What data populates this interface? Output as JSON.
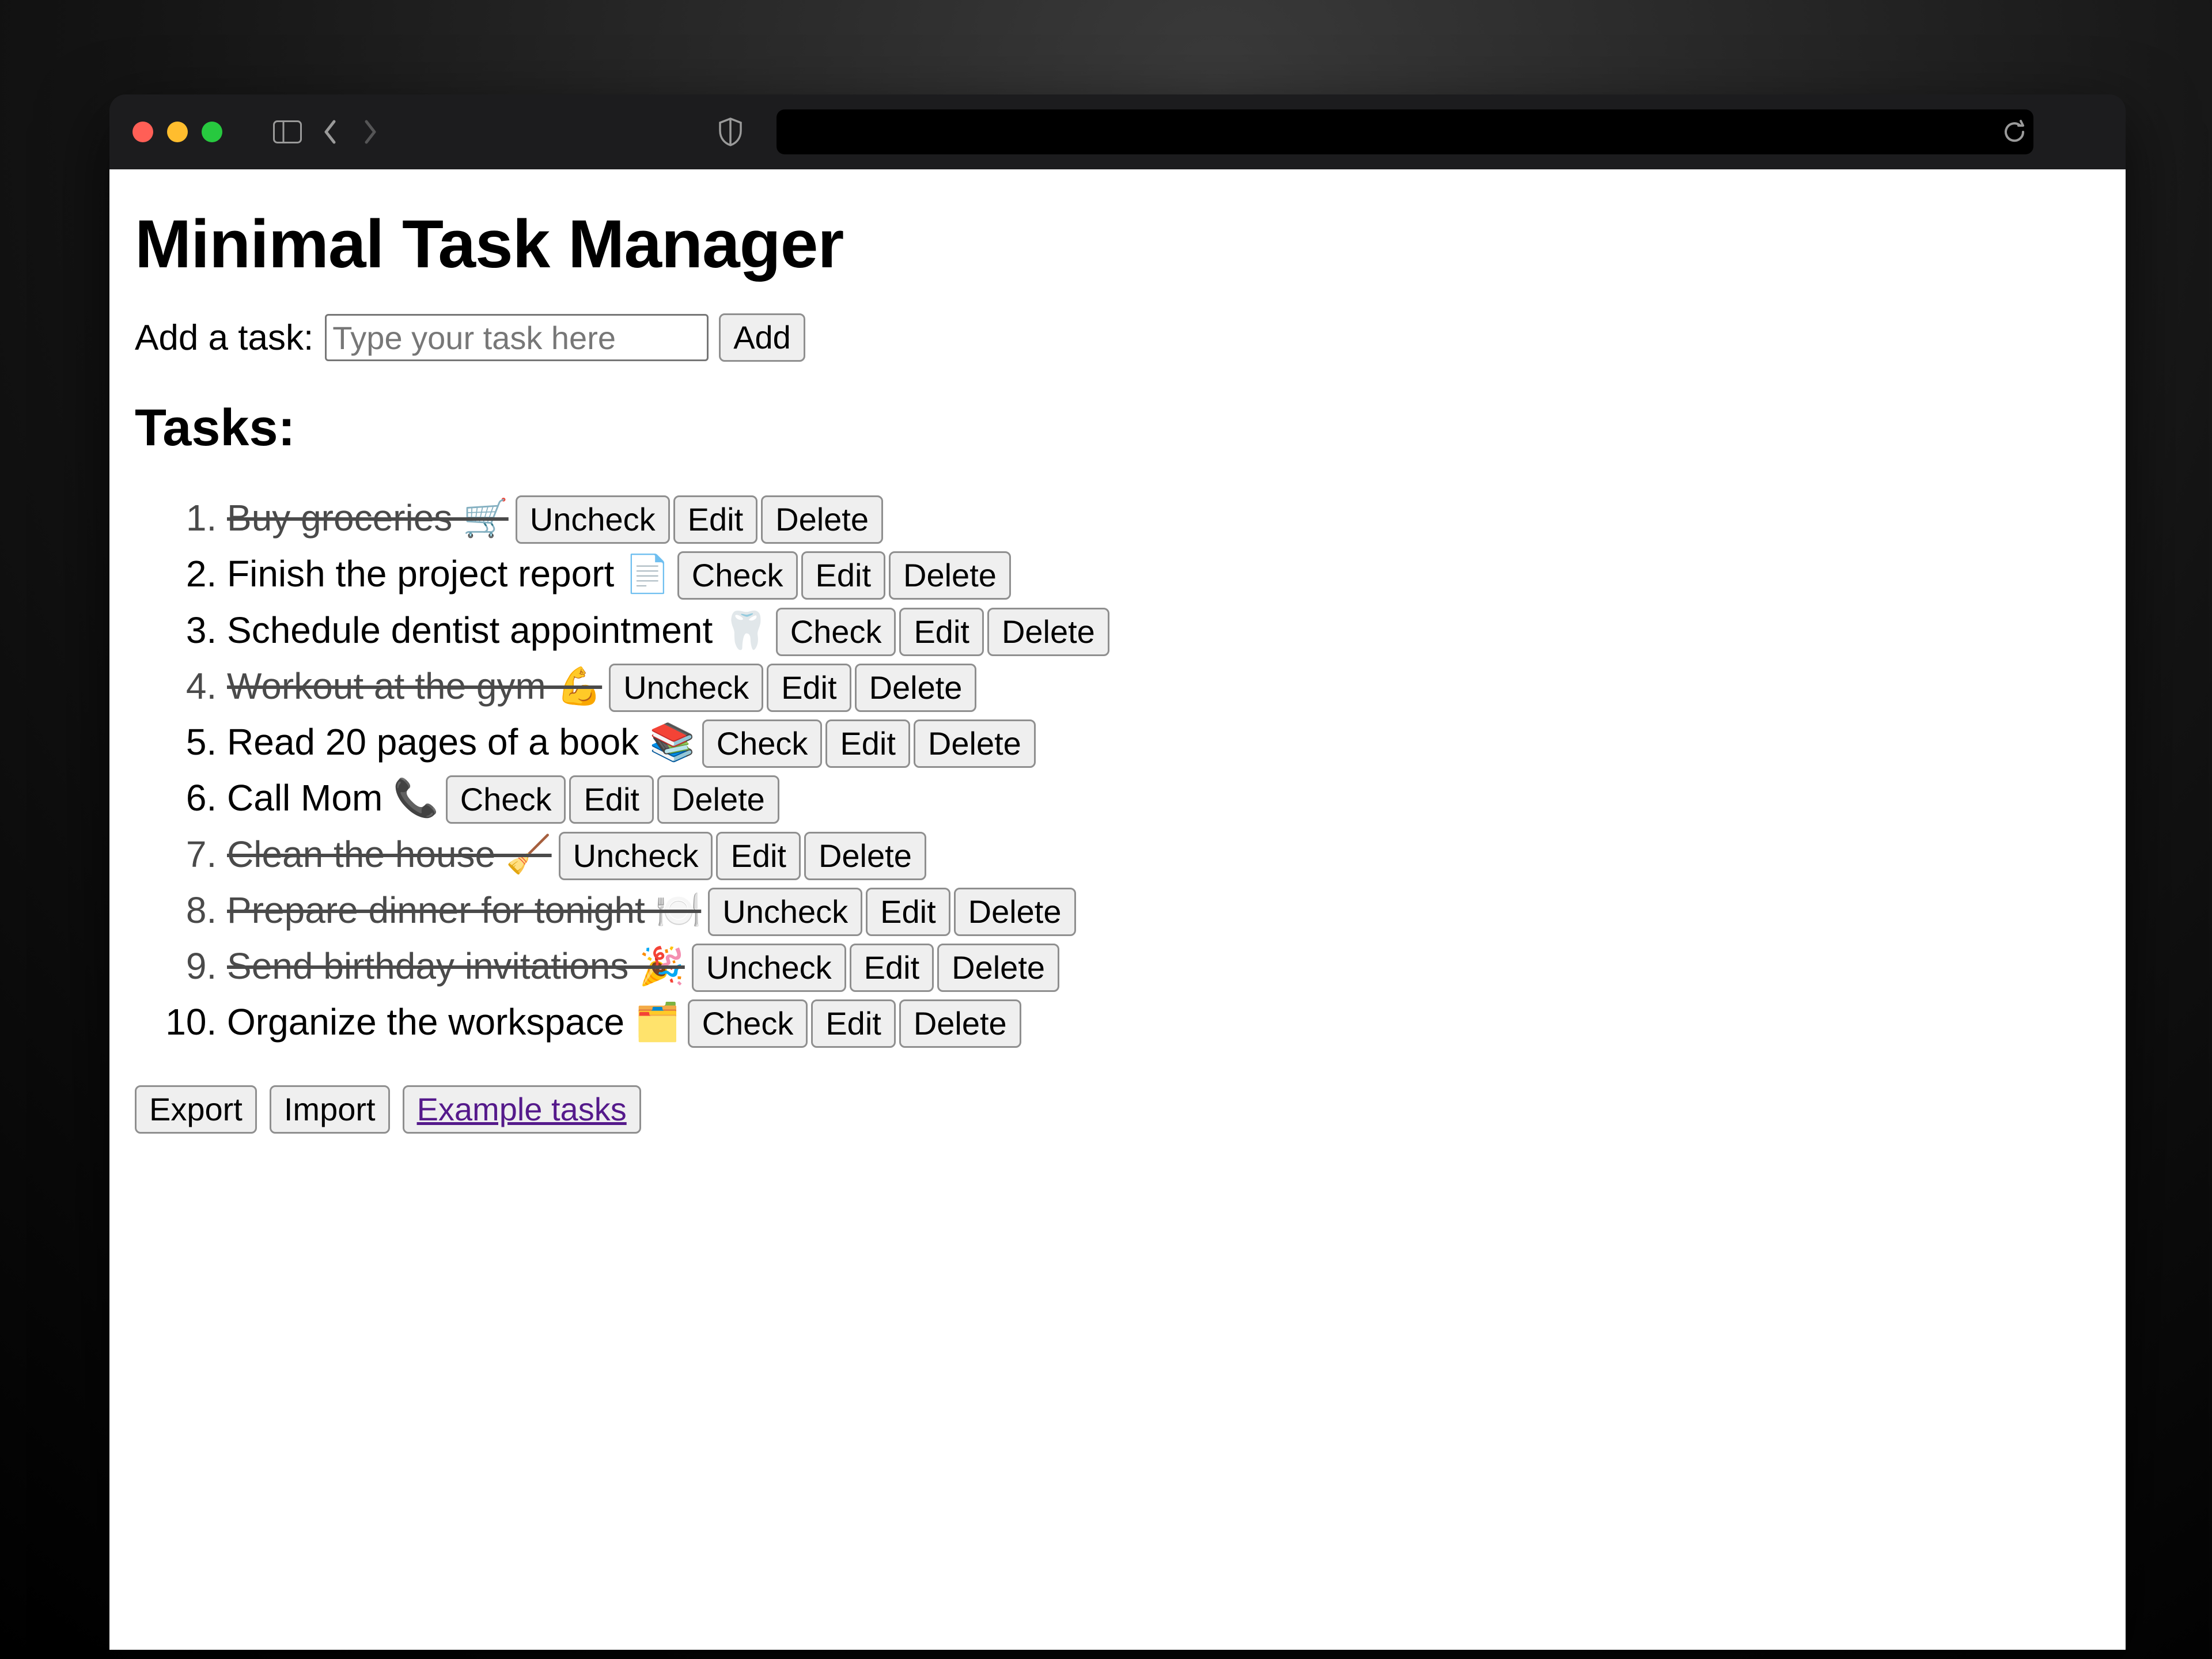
{
  "app": {
    "title": "Minimal Task Manager"
  },
  "add": {
    "label": "Add a task:",
    "placeholder": "Type your task here",
    "button": "Add"
  },
  "tasks_heading": "Tasks:",
  "row_buttons": {
    "check": "Check",
    "uncheck": "Uncheck",
    "edit": "Edit",
    "delete": "Delete"
  },
  "tasks": [
    {
      "text": "Buy groceries 🛒",
      "done": true
    },
    {
      "text": "Finish the project report 📄",
      "done": false
    },
    {
      "text": "Schedule dentist appointment 🦷",
      "done": false
    },
    {
      "text": "Workout at the gym 💪",
      "done": true
    },
    {
      "text": "Read 20 pages of a book 📚",
      "done": false
    },
    {
      "text": "Call Mom 📞",
      "done": false
    },
    {
      "text": "Clean the house 🧹",
      "done": true
    },
    {
      "text": "Prepare dinner for tonight 🍽️",
      "done": true
    },
    {
      "text": "Send birthday invitations 🎉",
      "done": true
    },
    {
      "text": "Organize the workspace 🗂️",
      "done": false
    }
  ],
  "footer": {
    "export": "Export",
    "import": "Import",
    "example": "Example tasks"
  }
}
